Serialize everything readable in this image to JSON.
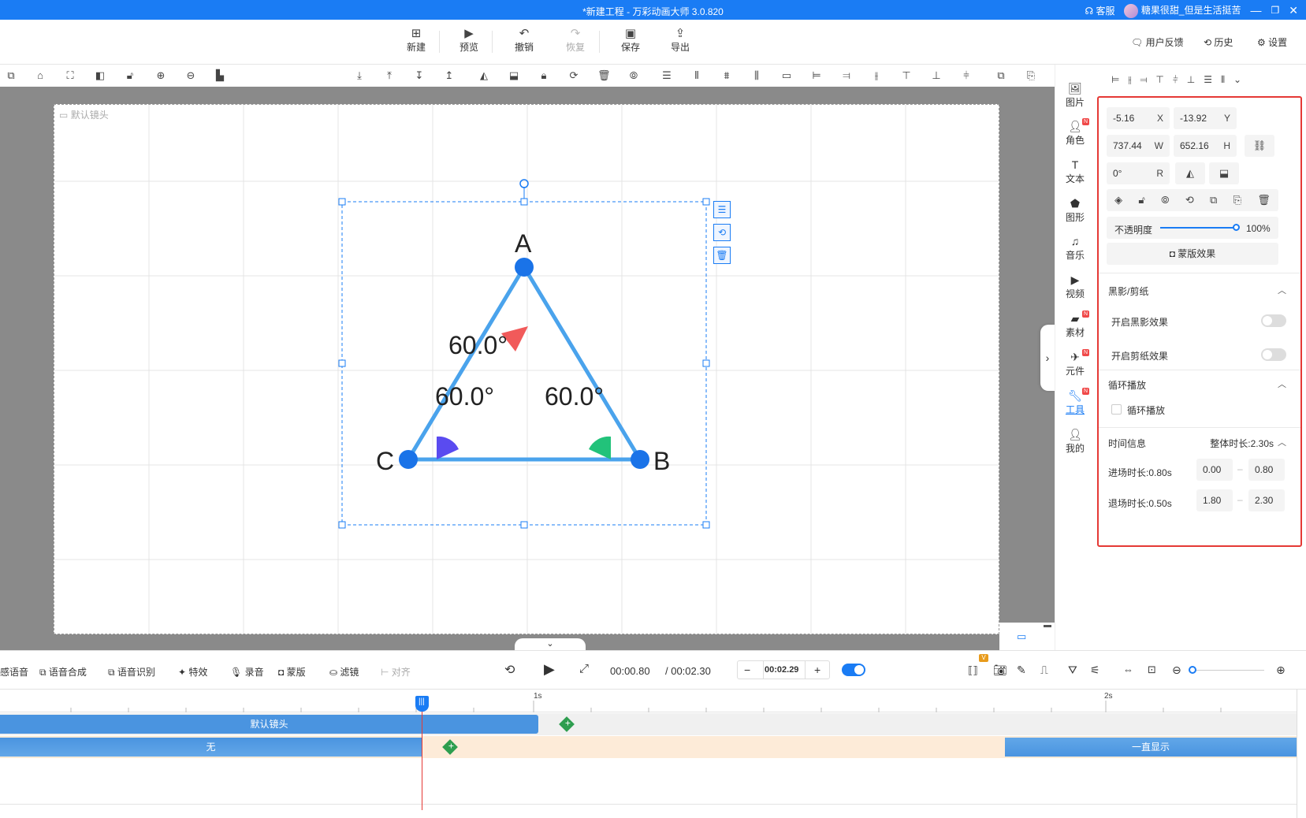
{
  "window": {
    "title": "*新建工程 - 万彩动画大师 3.0.820",
    "support_label": "客服",
    "username": "糖果很甜_但是生活挺苦"
  },
  "main_toolbar": {
    "new_label": "新建",
    "preview_label": "预览",
    "undo_label": "撤销",
    "redo_label": "恢复",
    "save_label": "保存",
    "export_label": "导出",
    "feedback_label": "用户反馈",
    "history_label": "历史",
    "settings_label": "设置"
  },
  "canvas": {
    "camera_label": "默认镜头",
    "triangle": {
      "vertex_a": "A",
      "vertex_b": "B",
      "vertex_c": "C",
      "angle_a": "60.0°",
      "angle_b": "60.0°",
      "angle_c": "60.0°",
      "colors": {
        "edge": "#4aa3ec",
        "vertex": "#1a73e8",
        "angle_a": "#f15a5a",
        "angle_b": "#22c27a",
        "angle_c": "#5a4bf0"
      }
    }
  },
  "right_sidebar": {
    "items": [
      {
        "label": "图片",
        "icon": "image-icon",
        "badge": false
      },
      {
        "label": "角色",
        "icon": "person-icon",
        "badge": true
      },
      {
        "label": "文本",
        "icon": "text-icon",
        "badge": false
      },
      {
        "label": "图形",
        "icon": "shape-icon",
        "badge": false
      },
      {
        "label": "音乐",
        "icon": "music-icon",
        "badge": false
      },
      {
        "label": "视频",
        "icon": "video-icon",
        "badge": false
      },
      {
        "label": "素材",
        "icon": "folder-icon",
        "badge": true
      },
      {
        "label": "元件",
        "icon": "component-icon",
        "badge": true
      },
      {
        "label": "工具",
        "icon": "wrench-icon",
        "badge": true
      },
      {
        "label": "我的",
        "icon": "user-icon",
        "badge": false
      }
    ],
    "badge_text": "N"
  },
  "properties": {
    "x_value": "-5.16",
    "x_label": "X",
    "y_value": "-13.92",
    "y_label": "Y",
    "w_value": "737.44",
    "w_label": "W",
    "h_value": "652.16",
    "h_label": "H",
    "r_value": "0°",
    "r_label": "R",
    "opacity_label": "不透明度",
    "opacity_value": "100%",
    "opacity_fraction": 1.0,
    "mask_label": "蒙版效果",
    "silhouette_section": "黑影/剪纸",
    "silhouette_toggle": "开启黑影效果",
    "papercut_toggle": "开启剪纸效果",
    "loop_section": "循环播放",
    "loop_checkbox": "循环播放",
    "time_section": "时间信息",
    "total_duration": "整体时长:2.30s",
    "enter_duration": "进场时长:0.80s",
    "enter_start": "0.00",
    "enter_end": "0.80",
    "exit_duration": "退场时长:0.50s",
    "exit_start": "1.80",
    "exit_end": "2.30"
  },
  "timeline_bar": {
    "tools": [
      "感语音",
      "语音合成",
      "语音识别",
      "特效",
      "录音",
      "蒙版",
      "滤镜",
      "对齐"
    ],
    "current_time": "00:00.80",
    "total_time": "/ 00:02.30",
    "step_value": "00:02.29"
  },
  "timeline": {
    "ruler_1s": "1s",
    "ruler_2s": "2s",
    "camera_track_label": "默认镜头",
    "object_enter_label": "无",
    "object_exit_label": "一直显示"
  }
}
